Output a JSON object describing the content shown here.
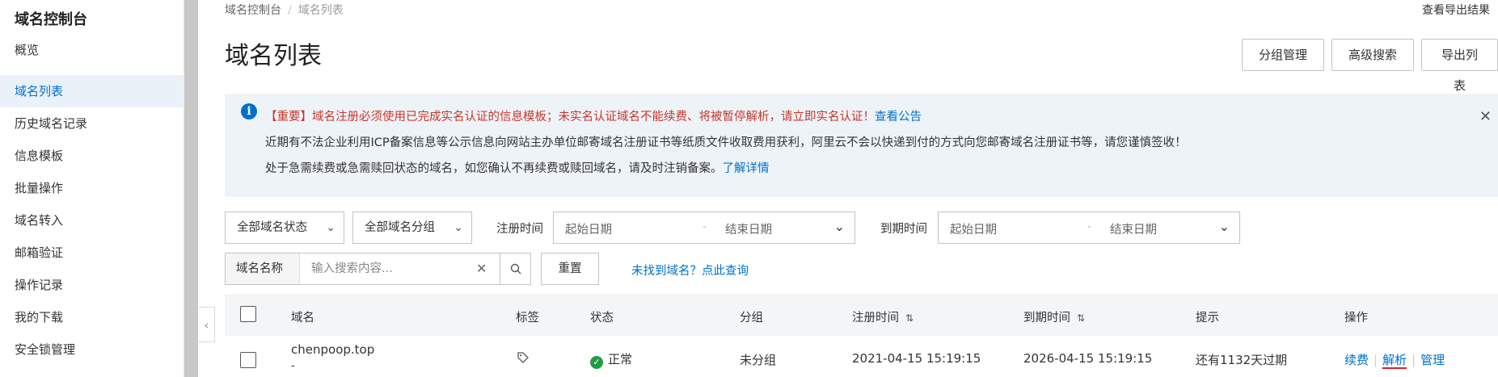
{
  "sidebar": {
    "title": "域名控制台",
    "items": [
      {
        "label": "概览"
      },
      {
        "label": "域名列表"
      },
      {
        "label": "历史域名记录"
      },
      {
        "label": "信息模板"
      },
      {
        "label": "批量操作"
      },
      {
        "label": "域名转入"
      },
      {
        "label": "邮箱验证"
      },
      {
        "label": "操作记录"
      },
      {
        "label": "我的下载"
      },
      {
        "label": "安全锁管理"
      }
    ],
    "active_index": 1
  },
  "breadcrumb": {
    "root": "域名控制台",
    "current": "域名列表"
  },
  "header": {
    "export_result_link": "查看导出结果",
    "title": "域名列表",
    "buttons": {
      "group_manage": "分组管理",
      "advanced_search": "高级搜索",
      "export_list": "导出列表"
    }
  },
  "notice": {
    "line1": "【重要】域名注册必须使用已完成实名认证的信息模板；未实名认证域名不能续费、将被暂停解析，请立即实名认证！",
    "line1_link": "查看公告",
    "line2": "近期有不法企业利用ICP备案信息等公示信息向网站主办单位邮寄域名注册证书等纸质文件收取费用获利，阿里云不会以快递到付的方式向您邮寄域名注册证书等，请您谨慎签收！",
    "line3": "处于急需续费或急需赎回状态的域名，如您确认不再续费或赎回域名，请及时注销备案。",
    "line3_link": "了解详情"
  },
  "filters": {
    "status_select": "全部域名状态",
    "group_select": "全部域名分组",
    "register_time_label": "注册时间",
    "expire_time_label": "到期时间",
    "start_date_placeholder": "起始日期",
    "end_date_placeholder": "结束日期",
    "search_prefix": "域名名称",
    "search_placeholder": "输入搜索内容...",
    "reset_button": "重置",
    "not_found_link": "未找到域名？点此查询"
  },
  "table": {
    "columns": {
      "domain": "域名",
      "tags": "标签",
      "status": "状态",
      "group": "分组",
      "register_time": "注册时间",
      "expire_time": "到期时间",
      "hint": "提示",
      "actions": "操作"
    },
    "rows": [
      {
        "domain": "chenpoop.top",
        "domain_sub": "-",
        "status": "正常",
        "group": "未分组",
        "register_time": "2021-04-15 15:19:15",
        "expire_time": "2026-04-15 15:19:15",
        "hint": "还有1132天过期",
        "actions": {
          "renew": "续费",
          "resolve": "解析",
          "manage": "管理"
        }
      }
    ]
  },
  "colors": {
    "accent": "#0070cc",
    "notice_warning": "#c7372a",
    "status_ok": "#1f9c44"
  }
}
